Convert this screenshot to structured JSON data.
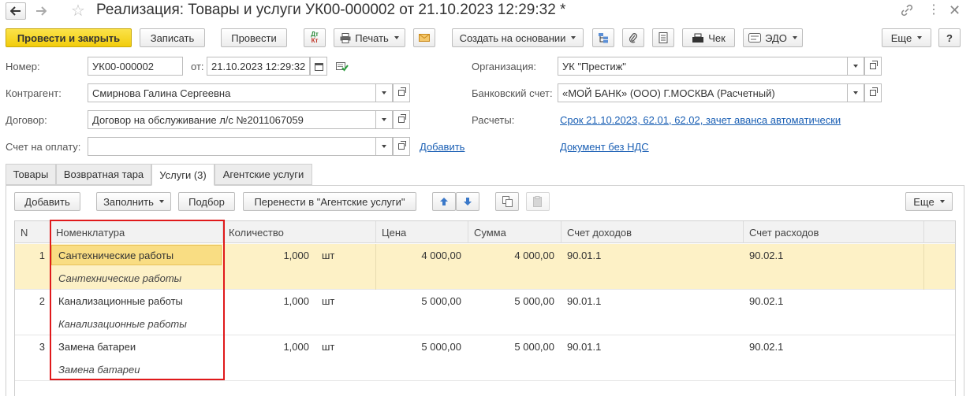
{
  "window": {
    "title": "Реализация: Товары и услуги УК00-000002 от 21.10.2023 12:29:32 *"
  },
  "toolbar": {
    "post_close": "Провести и закрыть",
    "save": "Записать",
    "post": "Провести",
    "dtkt_top": "Дт",
    "dtkt_bottom": "Кт",
    "print": "Печать",
    "create_based": "Создать на основании",
    "check": "Чек",
    "edo": "ЭДО",
    "more": "Еще",
    "help": "?"
  },
  "form": {
    "number_label": "Номер:",
    "number_value": "УК00-000002",
    "date_label": "от:",
    "date_value": "21.10.2023 12:29:32",
    "counterparty_label": "Контрагент:",
    "counterparty_value": "Смирнова Галина Сергеевна",
    "contract_label": "Договор:",
    "contract_value": "Договор на обслуживание л/с №2011067059",
    "invoice_label": "Счет на оплату:",
    "invoice_value": "",
    "add_link": "Добавить",
    "org_label": "Организация:",
    "org_value": "УК \"Престиж\"",
    "bank_label": "Банковский счет:",
    "bank_value": "«МОЙ БАНК» (ООО) Г.МОСКВА (Расчетный)",
    "settlements_label": "Расчеты:",
    "settlements_link": "Срок 21.10.2023, 62.01, 62.02, зачет аванса автоматически",
    "vat_link": "Документ без НДС"
  },
  "tabs": [
    {
      "label": "Товары"
    },
    {
      "label": "Возвратная тара"
    },
    {
      "label": "Услуги (3)"
    },
    {
      "label": "Агентские услуги"
    }
  ],
  "services_toolbar": {
    "add": "Добавить",
    "fill": "Заполнить",
    "select": "Подбор",
    "move": "Перенести в \"Агентские услуги\"",
    "more": "Еще"
  },
  "table": {
    "headers": [
      "N",
      "Номенклатура",
      "Количество",
      "Цена",
      "Сумма",
      "Счет доходов",
      "Счет расходов"
    ],
    "rows": [
      {
        "n": "1",
        "name": "Сантехнические работы",
        "content": "Сантехнические работы",
        "qty": "1,000",
        "unit": "шт",
        "price": "4 000,00",
        "sum": "4 000,00",
        "income": "90.01.1",
        "expense": "90.02.1"
      },
      {
        "n": "2",
        "name": "Канализационные работы",
        "content": "Канализационные работы",
        "qty": "1,000",
        "unit": "шт",
        "price": "5 000,00",
        "sum": "5 000,00",
        "income": "90.01.1",
        "expense": "90.02.1"
      },
      {
        "n": "3",
        "name": "Замена батареи",
        "content": "Замена батареи",
        "qty": "1,000",
        "unit": "шт",
        "price": "5 000,00",
        "sum": "5 000,00",
        "income": "90.01.1",
        "expense": "90.02.1"
      }
    ]
  },
  "colors": {
    "primary_button": "#f2cc0c",
    "selected_row": "#fdf1c6",
    "selected_cell": "#f9dd83",
    "highlight_frame": "#e0191b",
    "link": "#1a5fb4"
  }
}
